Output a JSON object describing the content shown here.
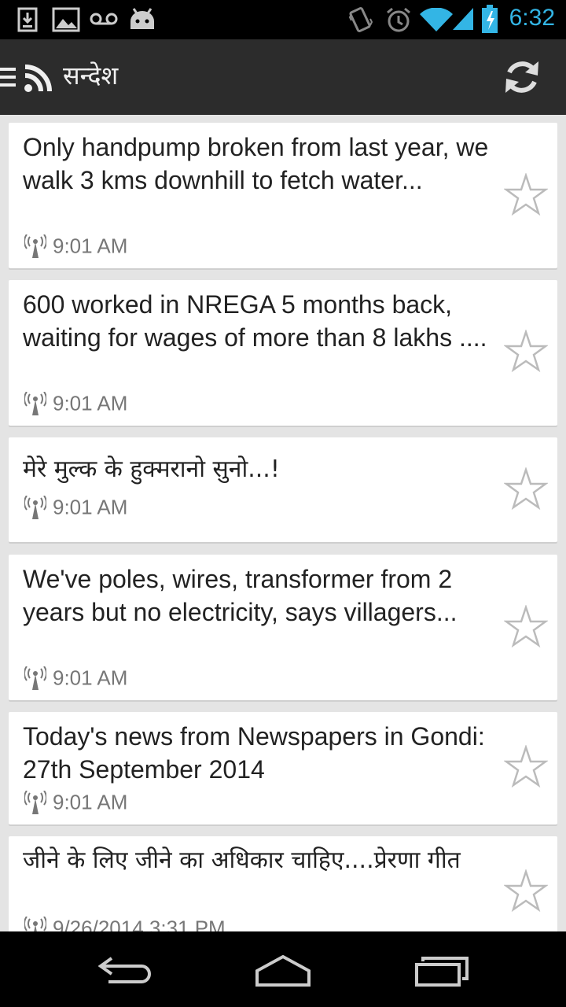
{
  "status_bar": {
    "time": "6:32",
    "icons": [
      "download-icon",
      "image-icon",
      "voicemail-icon",
      "android-icon",
      "vibrate-icon",
      "alarm-icon",
      "wifi-icon",
      "signal-icon",
      "battery-charging-icon"
    ]
  },
  "action_bar": {
    "title": "सन्देश",
    "left_icons": [
      "menu-icon",
      "rss-icon"
    ],
    "right_icon": "refresh-icon"
  },
  "messages": [
    {
      "title": "Only handpump broken from last year, we walk 3 kms downhill to fetch water...",
      "time": "9:01 AM",
      "starred": false
    },
    {
      "title": "600 worked in NREGA 5 months back, waiting for wages  of more than 8 lakhs ....",
      "time": "9:01 AM",
      "starred": false
    },
    {
      "title": "मेरे मुल्क के हुक्मरानो सुनो...!",
      "time": "9:01 AM",
      "starred": false
    },
    {
      "title": "We've poles, wires, transformer from 2 years but no electricity, says villagers...",
      "time": "9:01 AM",
      "starred": false
    },
    {
      "title": "Today's news from Newspapers in Gondi: 27th September  2014",
      "time": "9:01 AM",
      "starred": false
    },
    {
      "title": "जीने के लिए जीने का  अधिकार चाहिए....प्रेरणा गीत",
      "time": "9/26/2014 3:31 PM",
      "starred": false
    }
  ],
  "nav_bar": {
    "buttons": [
      "back-icon",
      "home-icon",
      "recent-apps-icon"
    ]
  },
  "colors": {
    "accent": "#33b5e5",
    "action_bar": "#2c2c2c",
    "list_background": "#e4e4e4",
    "card": "#ffffff"
  }
}
